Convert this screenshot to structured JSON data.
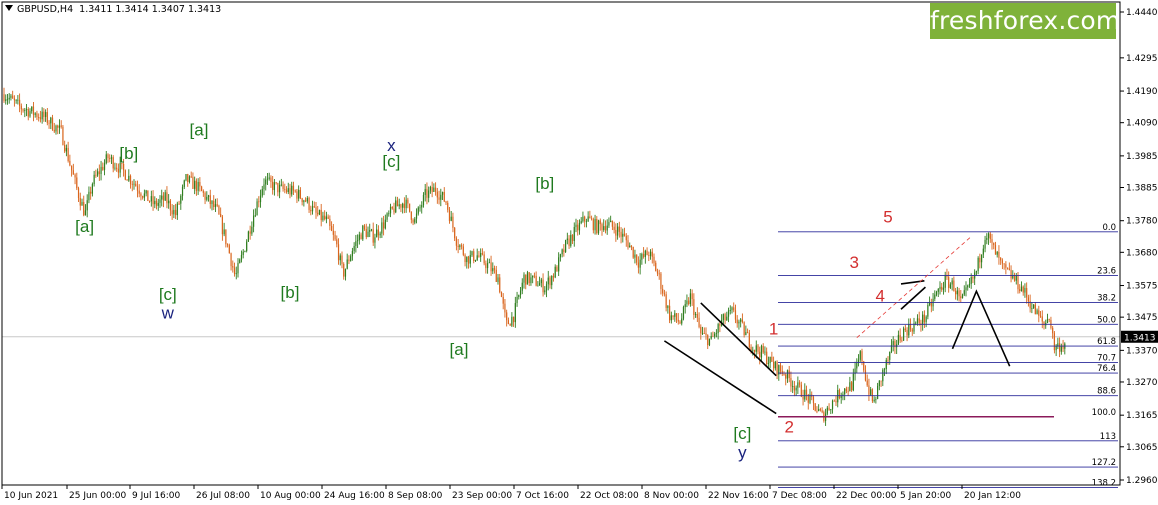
{
  "header": {
    "symbol": "GBPUSD,H4",
    "ohlc": "1.3411 1.3414 1.3407 1.3413"
  },
  "brand": {
    "text": "freshforex.com",
    "color": "#7fb23a"
  },
  "colors": {
    "up_candle": "#2e7d1e",
    "down_candle": "#d9641c",
    "fib_line": "#2a2a9a",
    "target_line": "#8b1a5a",
    "wave_green": "#1f7a1f",
    "wave_navy": "#1a237e",
    "wave_red": "#d32f2f",
    "price_tag_bg": "#000000"
  },
  "chart_data": {
    "type": "candlestick",
    "symbol": "GBPUSD",
    "timeframe": "H4",
    "ylim": [
      1.296,
      1.444
    ],
    "current_price": "1.3413",
    "y_ticks": [
      "1.4440",
      "1.4295",
      "1.4190",
      "1.4090",
      "1.3985",
      "1.3885",
      "1.3780",
      "1.3680",
      "1.3575",
      "1.3475",
      "1.3370",
      "1.3270",
      "1.3165",
      "1.3065",
      "1.2960"
    ],
    "x_ticks": [
      "10 Jun 2021",
      "25 Jun 00:00",
      "9 Jul 16:00",
      "26 Jul 08:00",
      "10 Aug 00:00",
      "24 Aug 16:00",
      "8 Sep 08:00",
      "23 Sep 00:00",
      "7 Oct 16:00",
      "22 Oct 08:00",
      "8 Nov 00:00",
      "22 Nov 16:00",
      "7 Dec 08:00",
      "22 Dec 00:00",
      "5 Jan 20:00",
      "20 Jan 12:00"
    ],
    "price_path": [
      [
        0,
        1.418
      ],
      [
        3,
        1.414
      ],
      [
        8,
        1.4105
      ],
      [
        11,
        1.406
      ],
      [
        14,
        1.388
      ],
      [
        15.6,
        1.38
      ],
      [
        17,
        1.39
      ],
      [
        20,
        1.398
      ],
      [
        23,
        1.3935
      ],
      [
        25,
        1.39
      ],
      [
        27,
        1.386
      ],
      [
        29,
        1.383
      ],
      [
        31,
        1.385
      ],
      [
        33,
        1.38
      ],
      [
        35,
        1.391
      ],
      [
        37,
        1.389
      ],
      [
        39,
        1.385
      ],
      [
        41,
        1.381
      ],
      [
        43,
        1.37
      ],
      [
        44.5,
        1.36
      ],
      [
        46,
        1.368
      ],
      [
        48,
        1.38
      ],
      [
        50,
        1.3905
      ],
      [
        53,
        1.388
      ],
      [
        56,
        1.387
      ],
      [
        58,
        1.3845
      ],
      [
        60,
        1.38
      ],
      [
        62,
        1.378
      ],
      [
        64,
        1.37
      ],
      [
        65.2,
        1.361
      ],
      [
        67,
        1.369
      ],
      [
        69,
        1.375
      ],
      [
        71,
        1.373
      ],
      [
        73,
        1.377
      ],
      [
        75,
        1.382
      ],
      [
        77,
        1.384
      ],
      [
        79,
        1.378
      ],
      [
        81,
        1.386
      ],
      [
        83,
        1.388
      ],
      [
        85,
        1.384
      ],
      [
        87,
        1.372
      ],
      [
        89,
        1.366
      ],
      [
        91,
        1.367
      ],
      [
        93,
        1.364
      ],
      [
        95,
        1.36
      ],
      [
        96.6,
        1.345
      ],
      [
        98,
        1.348
      ],
      [
        100,
        1.36
      ],
      [
        102,
        1.359
      ],
      [
        104,
        1.357
      ],
      [
        106,
        1.362
      ],
      [
        108,
        1.37
      ],
      [
        110,
        1.375
      ],
      [
        112,
        1.379
      ],
      [
        114,
        1.376
      ],
      [
        116,
        1.377
      ],
      [
        118,
        1.375
      ],
      [
        120,
        1.371
      ],
      [
        122,
        1.365
      ],
      [
        124,
        1.368
      ],
      [
        126,
        1.36
      ],
      [
        128,
        1.348
      ],
      [
        130,
        1.346
      ],
      [
        132,
        1.354
      ],
      [
        134,
        1.342
      ],
      [
        136,
        1.34
      ],
      [
        138,
        1.346
      ],
      [
        140,
        1.349
      ],
      [
        142,
        1.344
      ],
      [
        144,
        1.338
      ],
      [
        146,
        1.336
      ],
      [
        148,
        1.332
      ],
      [
        150,
        1.33
      ],
      [
        152,
        1.326
      ],
      [
        154,
        1.323
      ],
      [
        156,
        1.319
      ],
      [
        157.4,
        1.316
      ],
      [
        159,
        1.32
      ],
      [
        161,
        1.324
      ],
      [
        163,
        1.326
      ],
      [
        164.8,
        1.336
      ],
      [
        166,
        1.326
      ],
      [
        167.2,
        1.32
      ],
      [
        169,
        1.33
      ],
      [
        171,
        1.338
      ],
      [
        173,
        1.343
      ],
      [
        175,
        1.345
      ],
      [
        177,
        1.347
      ],
      [
        179,
        1.354
      ],
      [
        181,
        1.359
      ],
      [
        182.6,
        1.3575
      ],
      [
        184,
        1.352
      ],
      [
        185,
        1.355
      ],
      [
        187,
        1.362
      ],
      [
        188.8,
        1.3745
      ],
      [
        190,
        1.37
      ],
      [
        192,
        1.363
      ],
      [
        194,
        1.36
      ],
      [
        196,
        1.356
      ],
      [
        198,
        1.35
      ],
      [
        200,
        1.345
      ],
      [
        201,
        1.348
      ],
      [
        202,
        1.338
      ],
      [
        204,
        1.339
      ]
    ],
    "price_path_x_units": "bar index, 0 = 10 Jun 2021, 205 = 20 Jan + ~3 bars",
    "fibonacci": {
      "levels": [
        "0.0",
        "23.6",
        "38.2",
        "50.0",
        "61.8",
        "70.7",
        "76.4",
        "88.6",
        "100.0",
        "113",
        "127.2",
        "138.2"
      ],
      "ratios": [
        0,
        0.236,
        0.382,
        0.5,
        0.618,
        0.707,
        0.764,
        0.886,
        1.0,
        1.13,
        1.272,
        1.382
      ],
      "high": 1.3745,
      "low": 1.316
    },
    "wave_labels": [
      {
        "text": "[a]",
        "color": "wave_green",
        "x": 15.5,
        "y": 1.3745
      },
      {
        "text": "[b]",
        "color": "wave_green",
        "x": 24,
        "y": 1.3975
      },
      {
        "text": "[a]",
        "color": "wave_green",
        "x": 37.5,
        "y": 1.405
      },
      {
        "text": "[c]",
        "color": "wave_green",
        "x": 31.5,
        "y": 1.353
      },
      {
        "text": "w",
        "color": "wave_navy",
        "x": 31.5,
        "y": 1.347
      },
      {
        "text": "[b]",
        "color": "wave_green",
        "x": 55,
        "y": 1.3535
      },
      {
        "text": "x",
        "color": "wave_navy",
        "x": 74.5,
        "y": 1.4
      },
      {
        "text": "[c]",
        "color": "wave_green",
        "x": 74.5,
        "y": 1.395
      },
      {
        "text": "[a]",
        "color": "wave_green",
        "x": 87.5,
        "y": 1.3355
      },
      {
        "text": "[b]",
        "color": "wave_green",
        "x": 104,
        "y": 1.388
      },
      {
        "text": "[c]",
        "color": "wave_green",
        "x": 142,
        "y": 1.309
      },
      {
        "text": "y",
        "color": "wave_navy",
        "x": 142,
        "y": 1.303
      },
      {
        "text": "1",
        "color": "wave_red",
        "x": 148,
        "y": 1.342
      },
      {
        "text": "2",
        "color": "wave_red",
        "x": 151,
        "y": 1.311
      },
      {
        "text": "3",
        "color": "wave_red",
        "x": 163.5,
        "y": 1.363
      },
      {
        "text": "4",
        "color": "wave_red",
        "x": 168.5,
        "y": 1.3525
      },
      {
        "text": "5",
        "color": "wave_red",
        "x": 170,
        "y": 1.3775
      }
    ],
    "forecast_path": [
      [
        182.4,
        1.3375
      ],
      [
        187,
        1.3557
      ],
      [
        193.4,
        1.332
      ]
    ]
  }
}
